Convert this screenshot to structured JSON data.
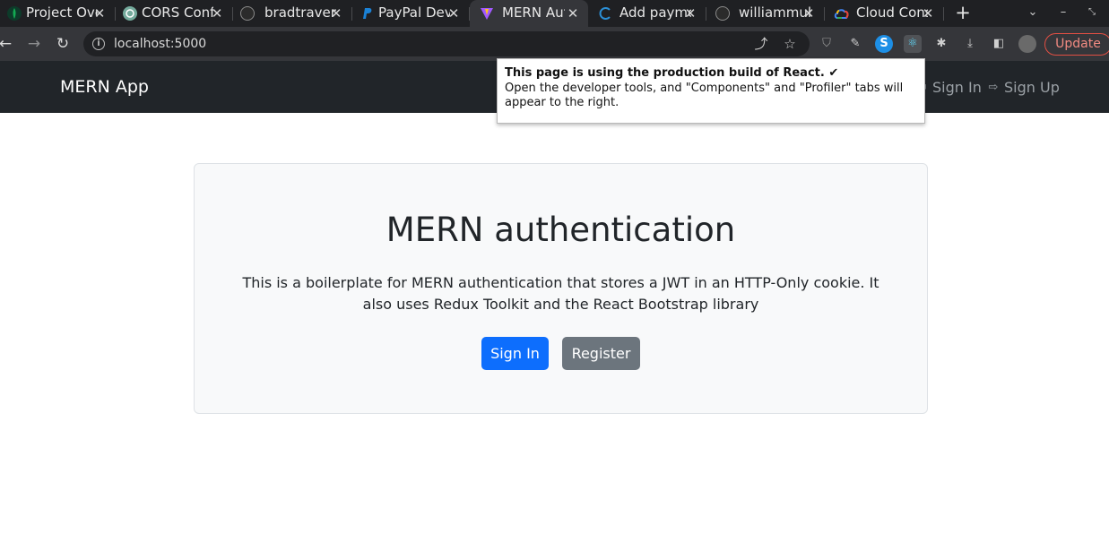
{
  "browser": {
    "tabs": [
      {
        "title": "Project Overview",
        "icon": "mongodb-leaf-icon",
        "active": false
      },
      {
        "title": "CORS Configuration",
        "icon": "openai-icon",
        "active": false
      },
      {
        "title": "bradtraversy",
        "icon": "github-icon",
        "active": false
      },
      {
        "title": "PayPal Developer",
        "icon": "paypal-icon",
        "active": false
      },
      {
        "title": "MERN Auth",
        "icon": "vite-icon",
        "active": true
      },
      {
        "title": "Add payment",
        "icon": "loading-spinner-icon",
        "active": false
      },
      {
        "title": "williammuli",
        "icon": "github-icon",
        "active": false
      },
      {
        "title": "Cloud Console",
        "icon": "google-cloud-icon",
        "active": false
      }
    ],
    "url": "localhost:5000",
    "update_label": "Update"
  },
  "navbar": {
    "brand": "MERN App",
    "sign_in": "Sign In",
    "sign_up": "Sign Up"
  },
  "devtools_popup": {
    "title": "This page is using the production build of React. ✔",
    "body": "Open the developer tools, and \"Components\" and \"Profiler\" tabs will appear to the right."
  },
  "hero": {
    "heading": "MERN authentication",
    "description": "This is a boilerplate for MERN authentication that stores a JWT in an HTTP-Only cookie. It also uses Redux Toolkit and the React Bootstrap library",
    "sign_in_button": "Sign In",
    "register_button": "Register"
  },
  "colors": {
    "primary": "#0d6efd",
    "secondary": "#6c757d",
    "navbar_bg": "#212529",
    "hero_bg": "#f8f9fa"
  }
}
